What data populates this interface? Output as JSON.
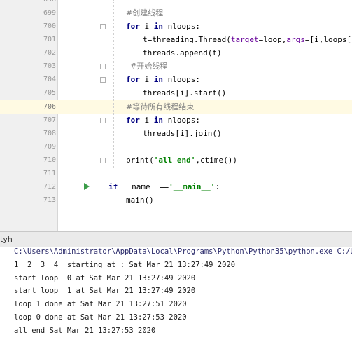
{
  "editor": {
    "lines": [
      {
        "num": "698",
        "text": ""
      },
      {
        "num": "699",
        "text": "#创建线程"
      },
      {
        "num": "700",
        "text": "for i in nloops:"
      },
      {
        "num": "701",
        "text": "t=threading.Thread(target=loop,args=[i,loops[i]])"
      },
      {
        "num": "702",
        "text": "threads.append(t)"
      },
      {
        "num": "703",
        "text": "#开始线程"
      },
      {
        "num": "704",
        "text": "for i in nloops:"
      },
      {
        "num": "705",
        "text": "threads[i].start()"
      },
      {
        "num": "706",
        "text": "#等待所有线程结束"
      },
      {
        "num": "707",
        "text": "for i in nloops:"
      },
      {
        "num": "708",
        "text": "threads[i].join()"
      },
      {
        "num": "709",
        "text": ""
      },
      {
        "num": "710",
        "text": "print('all end',ctime())"
      },
      {
        "num": "711",
        "text": ""
      },
      {
        "num": "712",
        "text": "if __name__=='__main__':"
      },
      {
        "num": "713",
        "text": "main()"
      }
    ],
    "current_line": "706",
    "tokens": {
      "kw_for": "for",
      "kw_in": "in",
      "kw_if": "if",
      "v_i": " i ",
      "nloops": " nloops:",
      "t_assign": "t=threading.Thread(",
      "p_target": "target",
      "eq": "=",
      "loop_comma": "loop,",
      "p_args": "args",
      "args_val": "=[i,loops[i]])",
      "print_open": "print(",
      "s_all_end": "'all end'",
      "print_close": ",ctime())",
      "name_cmp": " __name__==",
      "s_main": "'__main__'",
      "colon": ":"
    }
  },
  "run_panel": {
    "tab_label": "tyh",
    "output": [
      "C:\\Users\\Administrator\\AppData\\Local\\Programs\\Python\\Python35\\python.exe C:/Users",
      "1  2  3  4  starting at : Sat Mar 21 13:27:49 2020",
      "start loop  0 at Sat Mar 21 13:27:49 2020",
      "start loop  1 at Sat Mar 21 13:27:49 2020",
      "loop 1 done at Sat Mar 21 13:27:51 2020",
      "loop 0 done at Sat Mar 21 13:27:53 2020",
      "all end Sat Mar 21 13:27:53 2020"
    ]
  },
  "colors": {
    "keyword": "#000080",
    "comment": "#808080",
    "string": "#008000",
    "param": "#660099",
    "current_line_bg": "#fffae3",
    "gutter_bg": "#f0f0f0",
    "run_icon": "#3b9c48"
  },
  "icons": [
    "run-gutter-icon",
    "fold-marker-icon"
  ]
}
